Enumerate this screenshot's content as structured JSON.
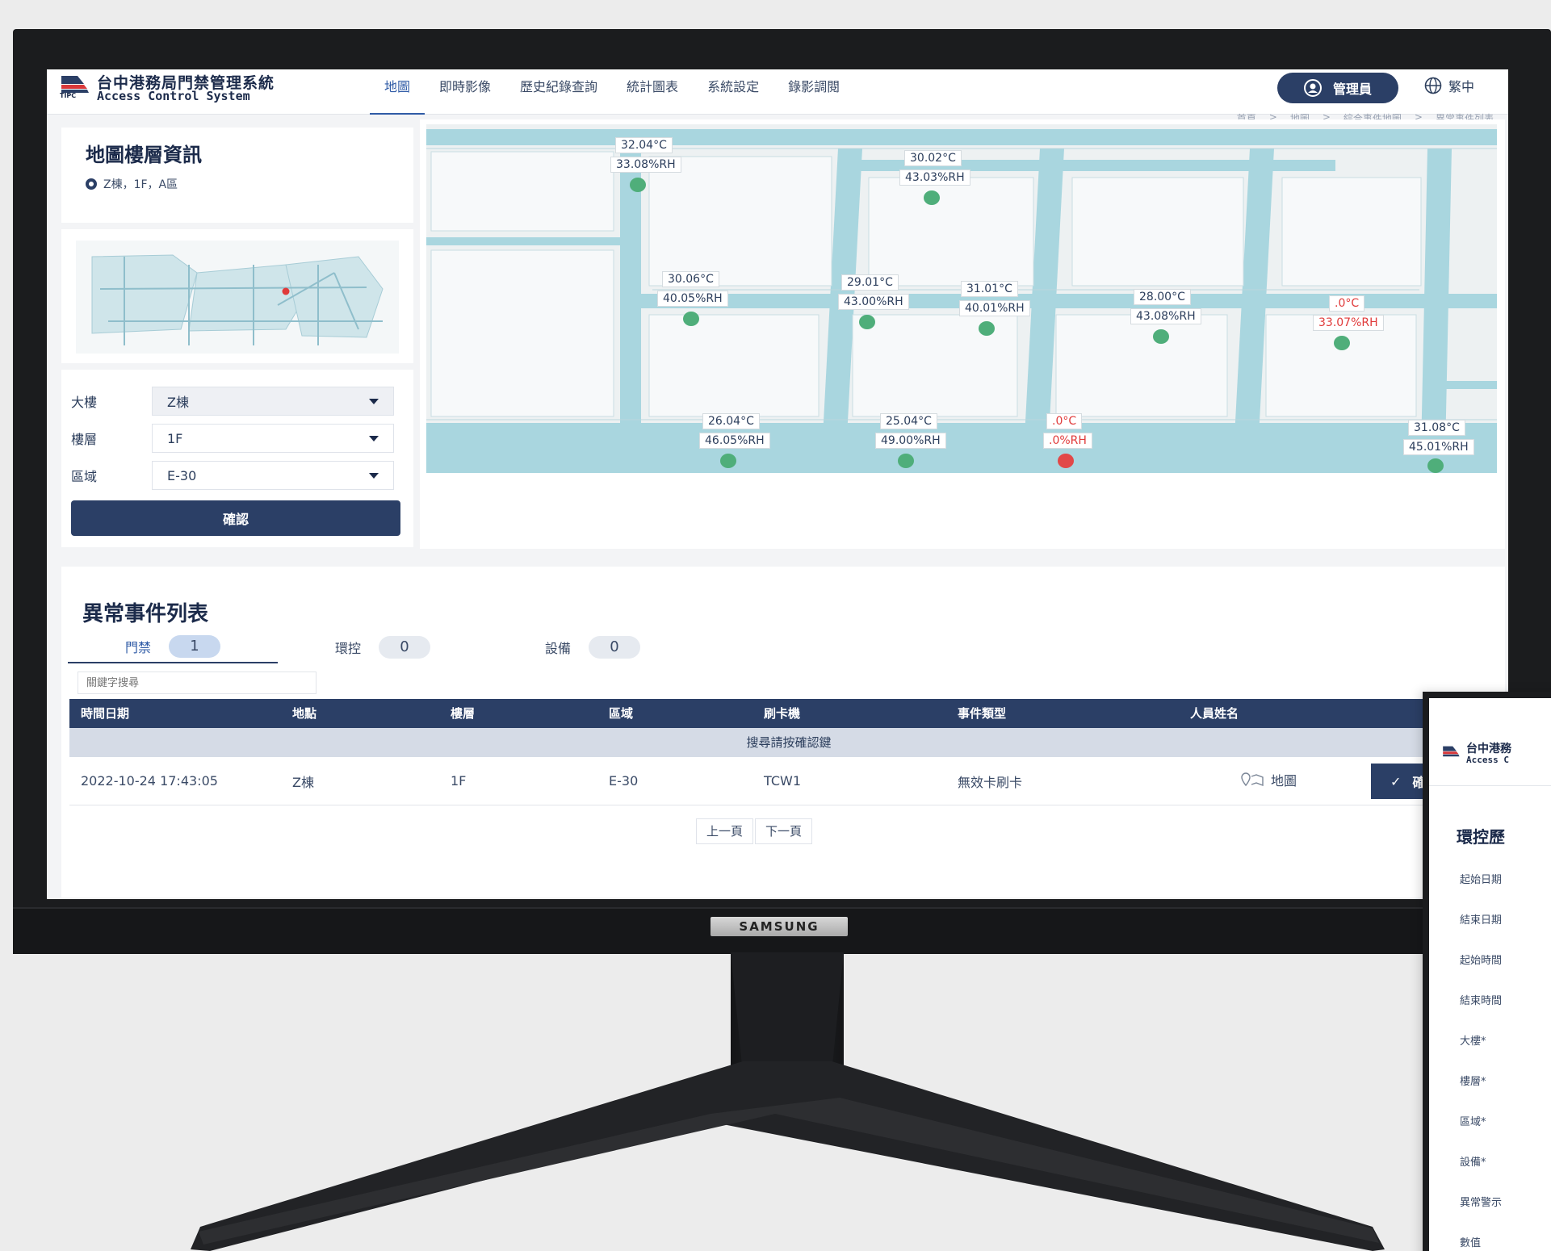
{
  "app": {
    "title": "台中港務局門禁管理系統",
    "subtitle": "Access Control System",
    "logo_abbr": "TIPC"
  },
  "nav": {
    "items": [
      {
        "label": "地圖",
        "active": true
      },
      {
        "label": "即時影像",
        "active": false
      },
      {
        "label": "歷史紀錄查詢",
        "active": false
      },
      {
        "label": "統計圖表",
        "active": false
      },
      {
        "label": "系統設定",
        "active": false
      },
      {
        "label": "錄影調閱",
        "active": false
      }
    ],
    "admin_label": "管理員",
    "language_label": "繁中"
  },
  "breadcrumb": [
    "首頁",
    ">",
    "地圖",
    ">",
    "綜合事件地圖",
    ">",
    "異常事件列表"
  ],
  "map_info": {
    "title": "地圖樓層資訊",
    "location": "Z棟，1F，A區"
  },
  "filters": {
    "building": {
      "label": "大樓",
      "value": "Z棟"
    },
    "floor": {
      "label": "樓層",
      "value": "1F"
    },
    "zone": {
      "label": "區域",
      "value": "E-30"
    },
    "confirm_label": "確認"
  },
  "sensors": [
    {
      "temp": "32.04°C",
      "rh": "33.08%RH",
      "alert": false
    },
    {
      "temp": "30.02°C",
      "rh": "43.03%RH",
      "alert": false
    },
    {
      "temp": "30.06°C",
      "rh": "40.05%RH",
      "alert": false
    },
    {
      "temp": "29.01°C",
      "rh": "43.00%RH",
      "alert": false
    },
    {
      "temp": "31.01°C",
      "rh": "40.01%RH",
      "alert": false
    },
    {
      "temp": "28.00°C",
      "rh": "43.08%RH",
      "alert": false
    },
    {
      "temp": ".0°C",
      "rh": "33.07%RH",
      "alert": true
    },
    {
      "temp": "26.04°C",
      "rh": "46.05%RH",
      "alert": false
    },
    {
      "temp": "25.04°C",
      "rh": "49.00%RH",
      "alert": false
    },
    {
      "temp": ".0°C",
      "rh": ".0%RH",
      "alert": true
    },
    {
      "temp": "31.08°C",
      "rh": "45.01%RH",
      "alert": false
    }
  ],
  "events": {
    "title": "異常事件列表",
    "tabs": [
      {
        "label": "門禁",
        "count": "1",
        "active": true
      },
      {
        "label": "環控",
        "count": "0",
        "active": false
      },
      {
        "label": "設備",
        "count": "0",
        "active": false
      }
    ],
    "search_placeholder": "關鍵字搜尋",
    "columns": [
      "時間日期",
      "地點",
      "樓層",
      "區域",
      "刷卡機",
      "事件類型",
      "人員姓名"
    ],
    "hint": "搜尋請按確認鍵",
    "rows": [
      {
        "datetime": "2022-10-24 17:43:05",
        "place": "Z棟",
        "floor": "1F",
        "zone": "E-30",
        "reader": "TCW1",
        "event_type": "無效卡刷卡",
        "map_label": "地圖",
        "ack_label": "確"
      }
    ],
    "prev_label": "上一頁",
    "next_label": "下一頁"
  },
  "second_window": {
    "title": "台中港務",
    "subtitle": "Access C",
    "heading": "環控歷",
    "fields": [
      "起始日期",
      "結束日期",
      "起始時間",
      "結束時間",
      "大樓*",
      "樓層*",
      "區域*",
      "設備*",
      "異常警示",
      "數值"
    ]
  },
  "monitor": {
    "brand": "SAMSUNG"
  },
  "colors": {
    "primary": "#2b3f66",
    "accent": "#2f5ba6",
    "alert": "#e03a3a",
    "map_corridor": "#a9d6df"
  }
}
